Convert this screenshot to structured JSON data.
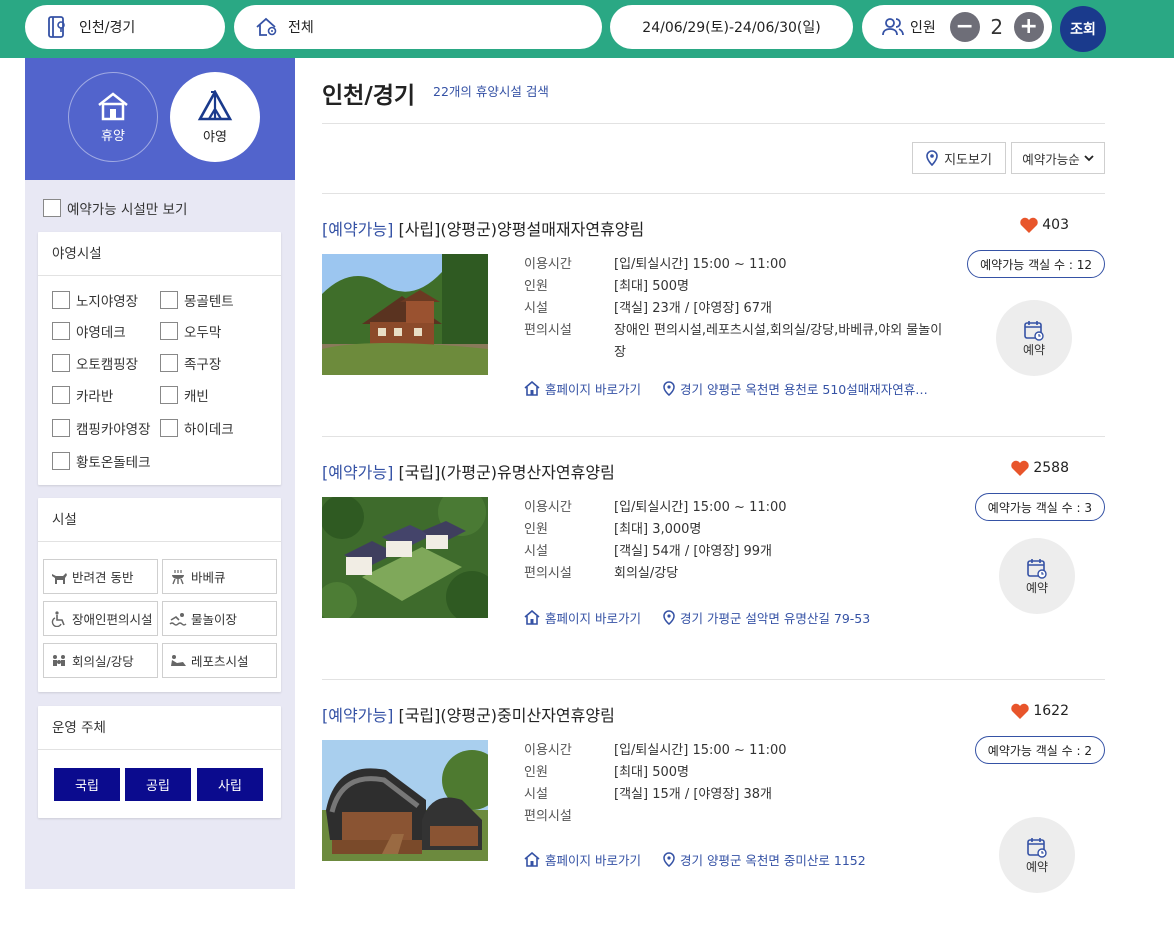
{
  "search": {
    "region": "인천/경기",
    "area": "전체",
    "dates": "24/06/29(토)-24/06/30(일)",
    "people_label": "인원",
    "people_count": "2",
    "minus": "−",
    "plus": "+",
    "submit": "조회"
  },
  "sidebar": {
    "categories": [
      {
        "label": "휴양",
        "icon": "house-icon"
      },
      {
        "label": "야영",
        "icon": "tent-icon"
      }
    ],
    "only_available": "예약가능 시설만 보기",
    "camp_title": "야영시설",
    "camp_options": [
      "노지야영장",
      "몽골텐트",
      "야영데크",
      "오두막",
      "오토캠핑장",
      "족구장",
      "카라반",
      "캐빈",
      "캠핑카야영장",
      "하이데크",
      "황토온돌테크"
    ],
    "facility_title": "시설",
    "facilities": [
      {
        "label": "반려견 동반",
        "icon": "dog-icon"
      },
      {
        "label": "바베큐",
        "icon": "grill-icon"
      },
      {
        "label": "장애인편의시설",
        "icon": "wheelchair-icon"
      },
      {
        "label": "물놀이장",
        "icon": "swim-icon"
      },
      {
        "label": "회의실/강당",
        "icon": "meeting-icon"
      },
      {
        "label": "레포츠시설",
        "icon": "sports-icon"
      }
    ],
    "operator_title": "운영 주체",
    "operators": [
      "국립",
      "공립",
      "사립"
    ]
  },
  "main": {
    "title": "인천/경기",
    "result_count": "22개의 휴양시설 검색",
    "map_button": "지도보기",
    "sort": "예약가능순",
    "labels": {
      "time": "이용시간",
      "people": "인원",
      "facility": "시설",
      "amenity": "편의시설",
      "homepage": "홈페이지 바로가기",
      "reserve": "예약"
    },
    "items": [
      {
        "status": "[예약가능]",
        "name": "[사립](양평군)양평설매재자연휴양림",
        "likes": "403",
        "available_rooms": "예약가능 객실 수 : 12",
        "time": "[입/퇴실시간] 15:00 ~ 11:00",
        "people": "[최대] 500명",
        "facility": "[객실] 23개 / [야영장] 67개",
        "amenity": "장애인 편의시설,레포츠시설,회의실/강당,바베큐,야외 물놀이장",
        "address": "경기 양평군 옥천면 용천로 510설매재자연휴…"
      },
      {
        "status": "[예약가능]",
        "name": "[국립](가평군)유명산자연휴양림",
        "likes": "2588",
        "available_rooms": "예약가능 객실 수 : 3",
        "time": "[입/퇴실시간] 15:00 ~ 11:00",
        "people": "[최대] 3,000명",
        "facility": "[객실] 54개 / [야영장] 99개",
        "amenity": "회의실/강당",
        "address": "경기 가평군 설악면 유명산길 79-53"
      },
      {
        "status": "[예약가능]",
        "name": "[국립](양평군)중미산자연휴양림",
        "likes": "1622",
        "available_rooms": "예약가능 객실 수 : 2",
        "time": "[입/퇴실시간] 15:00 ~ 11:00",
        "people": "[최대] 500명",
        "facility": "[객실] 15개 / [야영장] 38개",
        "amenity": "",
        "address": "경기 양평군 옥천면 중미산로 1152"
      }
    ]
  },
  "colors": {
    "topbar": "#2aa884",
    "category_panel": "#5264cc",
    "accent": "#3552a5",
    "operator_button": "#0b0b8e",
    "heart": "#e8552b"
  }
}
